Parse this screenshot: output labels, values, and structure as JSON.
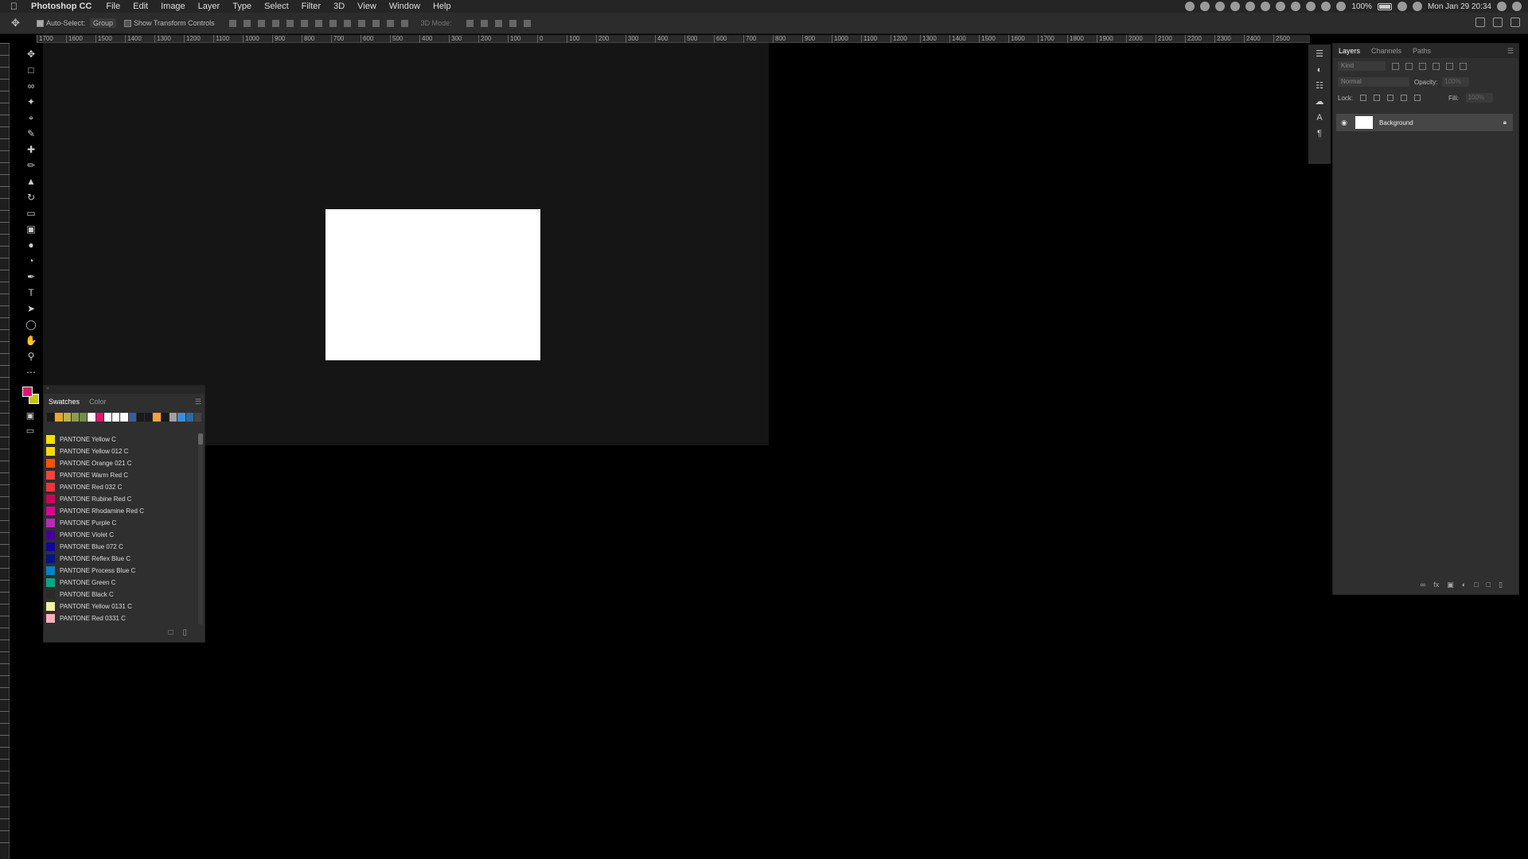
{
  "menubar": {
    "app_name": "Photoshop CC",
    "items": [
      "File",
      "Edit",
      "Image",
      "Layer",
      "Type",
      "Select",
      "Filter",
      "3D",
      "View",
      "Window",
      "Help"
    ],
    "battery": "100%",
    "datetime": "Mon Jan 29 20:34"
  },
  "options": {
    "auto_select_label": "Auto-Select:",
    "auto_select_value": "Group",
    "transform_controls_label": "Show Transform Controls",
    "mode_3d_label": "3D Mode:"
  },
  "ruler": {
    "labels": [
      "1700",
      "1600",
      "1500",
      "1400",
      "1300",
      "1200",
      "1100",
      "1000",
      "900",
      "800",
      "700",
      "600",
      "500",
      "400",
      "300",
      "200",
      "100",
      "0",
      "100",
      "200",
      "300",
      "400",
      "500",
      "600",
      "700",
      "800",
      "900",
      "1000",
      "1100",
      "1200",
      "1300",
      "1400",
      "1500",
      "1600",
      "1700",
      "1800",
      "1900",
      "2000",
      "2100",
      "2200",
      "2300",
      "2400",
      "2500"
    ]
  },
  "swatches_panel": {
    "tabs": [
      "Swatches",
      "Color"
    ],
    "recent_colors": [
      "#1a1a1a",
      "#e7a62d",
      "#b9b24f",
      "#8a9d4f",
      "#6e8e4a",
      "#ffffff",
      "#e0176f",
      "#ffffff",
      "#ffffff",
      "#ffffff",
      "#3c5aa0",
      "#1a1a1a",
      "#1a1a1a",
      "#f3a13c",
      "#1a1a1a",
      "#a0a0a0",
      "#3b8fd6",
      "#2c6aa0",
      "#444444"
    ],
    "items": [
      {
        "name": "PANTONE Yellow C",
        "color": "#fedd00"
      },
      {
        "name": "PANTONE Yellow 012 C",
        "color": "#ffd700"
      },
      {
        "name": "PANTONE Orange 021 C",
        "color": "#fe5000"
      },
      {
        "name": "PANTONE Warm Red C",
        "color": "#f9423a"
      },
      {
        "name": "PANTONE Red 032 C",
        "color": "#ef3340"
      },
      {
        "name": "PANTONE Rubine Red C",
        "color": "#ce0058"
      },
      {
        "name": "PANTONE Rhodamine Red C",
        "color": "#e10098"
      },
      {
        "name": "PANTONE Purple C",
        "color": "#bb29bb"
      },
      {
        "name": "PANTONE Violet C",
        "color": "#440099"
      },
      {
        "name": "PANTONE Blue 072 C",
        "color": "#10069f"
      },
      {
        "name": "PANTONE Reflex Blue C",
        "color": "#001489"
      },
      {
        "name": "PANTONE Process Blue C",
        "color": "#0085ca"
      },
      {
        "name": "PANTONE Green C",
        "color": "#00ab84"
      },
      {
        "name": "PANTONE Black C",
        "color": "#2d2926"
      },
      {
        "name": "PANTONE Yellow 0131 C",
        "color": "#f2f0a1"
      },
      {
        "name": "PANTONE Red 0331 C",
        "color": "#fcaebb"
      }
    ]
  },
  "layers_panel": {
    "tabs": [
      "Layers",
      "Channels",
      "Paths"
    ],
    "filter_placeholder": "Kind",
    "blend_mode": "Normal",
    "opacity_label": "Opacity:",
    "opacity_value": "100%",
    "lock_label": "Lock:",
    "fill_label": "Fill:",
    "fill_value": "100%",
    "layers": [
      {
        "name": "Background"
      }
    ]
  },
  "colors": {
    "foreground": "#e0176f",
    "background": "#c5c500"
  }
}
